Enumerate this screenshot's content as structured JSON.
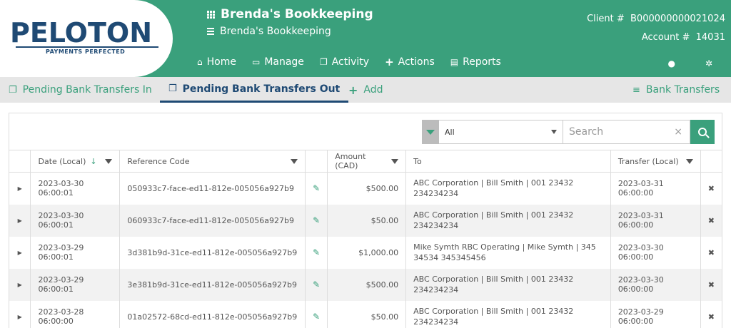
{
  "brand": {
    "name": "PELOTON",
    "tagline": "PAYMENTS PERFECTED",
    "colors": {
      "primary": "#3aa07c",
      "navy": "#1f4a74"
    }
  },
  "header": {
    "title": "Brenda's Bookkeeping",
    "subtitle": "Brenda's Bookkeeping",
    "client_label": "Client #",
    "client_number": "B000000000021024",
    "account_label": "Account #",
    "account_number": "14031"
  },
  "nav": [
    {
      "label": "Home",
      "icon": "home-icon"
    },
    {
      "label": "Manage",
      "icon": "monitor-icon"
    },
    {
      "label": "Activity",
      "icon": "document-icon"
    },
    {
      "label": "Actions",
      "icon": "plus-icon"
    },
    {
      "label": "Reports",
      "icon": "report-icon"
    }
  ],
  "tabs": {
    "in": "Pending Bank Transfers In",
    "out": "Pending Bank Transfers Out",
    "add": "Add",
    "bank": "Bank Transfers"
  },
  "filter": {
    "selected": "All",
    "search_placeholder": "Search"
  },
  "table": {
    "headers": {
      "date": "Date (Local)",
      "reference": "Reference Code",
      "amount": "Amount (CAD)",
      "to": "To",
      "transfer": "Transfer (Local)"
    },
    "rows": [
      {
        "date": "2023-03-30 06:00:01",
        "reference": "050933c7-face-ed11-812e-005056a927b9",
        "amount": "$500.00",
        "to_line1": "ABC Corporation | Bill Smith | 001 23432",
        "to_line2": "234234234",
        "transfer": "2023-03-31 06:00:00"
      },
      {
        "date": "2023-03-30 06:00:01",
        "reference": "060933c7-face-ed11-812e-005056a927b9",
        "amount": "$50.00",
        "to_line1": "ABC Corporation | Bill Smith | 001 23432",
        "to_line2": "234234234",
        "transfer": "2023-03-31 06:00:00"
      },
      {
        "date": "2023-03-29 06:00:01",
        "reference": "3d381b9d-31ce-ed11-812e-005056a927b9",
        "amount": "$1,000.00",
        "to_line1": "Mike Symth RBC Operating | Mike Symth | 345",
        "to_line2": "34534 345345456",
        "transfer": "2023-03-30 06:00:00"
      },
      {
        "date": "2023-03-29 06:00:01",
        "reference": "3e381b9d-31ce-ed11-812e-005056a927b9",
        "amount": "$500.00",
        "to_line1": "ABC Corporation | Bill Smith | 001 23432",
        "to_line2": "234234234",
        "transfer": "2023-03-30 06:00:00"
      },
      {
        "date": "2023-03-28 06:00:00",
        "reference": "01a02572-68cd-ed11-812e-005056a927b9",
        "amount": "$50.00",
        "to_line1": "ABC Corporation | Bill Smith | 001 23432",
        "to_line2": "234234234",
        "transfer": "2023-03-29 06:00:00"
      }
    ]
  }
}
